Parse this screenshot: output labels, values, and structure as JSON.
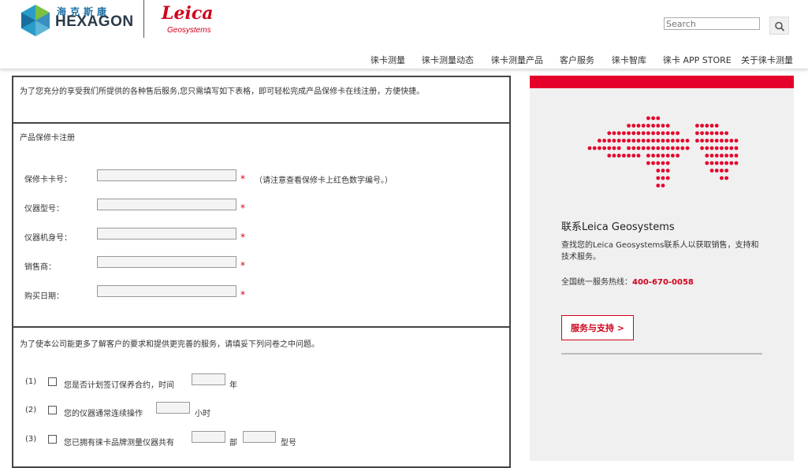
{
  "header": {
    "hexagon_cn": "海克斯康",
    "hexagon_en": "HEXAGON",
    "leica_logo": "Leica",
    "leica_sub": "Geosystems",
    "search_placeholder": "Search"
  },
  "nav": [
    {
      "label": "徕卡测量"
    },
    {
      "label": "徕卡测量动态"
    },
    {
      "label": "徕卡测量产品"
    },
    {
      "label": "客户服务"
    },
    {
      "label": "徕卡智库"
    },
    {
      "label": "徕卡 APP STORE"
    },
    {
      "label": "关于徕卡测量"
    }
  ],
  "intro": "为了您充分的享受我们所提供的各种售后服务,您只需填写如下表格，即可轻松完成产品保修卡在线注册，方便快捷。",
  "registration": {
    "title": "产品保修卡注册",
    "fields": [
      {
        "label": "保修卡卡号：",
        "required": "*",
        "hint": "（请注意查看保修卡上红色数字编号。）"
      },
      {
        "label": "仪器型号：",
        "required": "*"
      },
      {
        "label": "仪器机身号：",
        "required": "*"
      },
      {
        "label": "销售商：",
        "required": "*"
      },
      {
        "label": "购买日期：",
        "required": "*"
      }
    ]
  },
  "survey": {
    "intro": "为了使本公司能更多了解客户的要求和提供更完善的服务，请填妥下列问卷之中问题。",
    "questions": [
      {
        "num": "(1)",
        "text": "您是否计划签订保养合约，时间",
        "unit": "年"
      },
      {
        "num": "(2)",
        "text": "您的仪器通常连续操作",
        "unit": "小时"
      },
      {
        "num": "(3)",
        "text": "您已拥有徕卡品牌测量仪器共有",
        "unit": "部",
        "unit2": "型号"
      }
    ]
  },
  "sidebar": {
    "contact_title": "联系Leica Geosystems",
    "contact_desc": "查找您的Leica Geosystems联系人以获取销售，支持和技术服务。",
    "hotline_label": "全国统一服务热线：",
    "hotline_number": "400-670-0058",
    "support_button": "服务与支持 >"
  },
  "colors": {
    "brand_red": "#e4002b",
    "hexagon_blue": "#1e6fa3"
  }
}
